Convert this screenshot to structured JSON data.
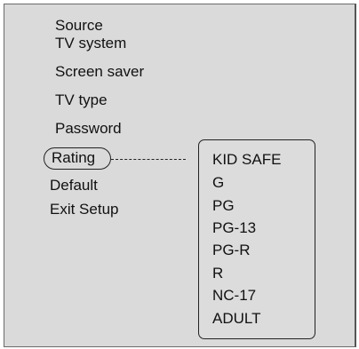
{
  "menu": {
    "items": [
      {
        "label": "Source"
      },
      {
        "label": "TV system"
      },
      {
        "label": "Screen saver"
      },
      {
        "label": "TV type"
      },
      {
        "label": "Password"
      },
      {
        "label": "Rating"
      },
      {
        "label": "Default"
      },
      {
        "label": "Exit Setup"
      }
    ],
    "selected": "Rating"
  },
  "rating_options": [
    "KID SAFE",
    "G",
    "PG",
    "PG-13",
    "PG-R",
    "R",
    "NC-17",
    "ADULT"
  ],
  "colors": {
    "background": "#dadada",
    "text": "#111111",
    "border": "#222222"
  }
}
